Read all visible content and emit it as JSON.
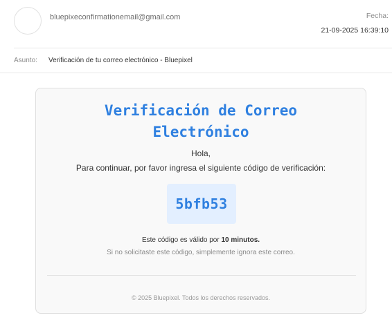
{
  "email": {
    "sender": "bluepixeconfirmationemail@gmail.com",
    "date_label": "Fecha:",
    "date_value": "21-09-2025 16:39:10",
    "subject_label": "Asunto:",
    "subject": "Verificación de tu correo electrónico - Bluepixel"
  },
  "body": {
    "title_line1": "Verificación de Correo",
    "title_line2": "Electrónico",
    "greeting": "Hola,",
    "instruction": "Para continuar, por favor ingresa el siguiente código de verificación:",
    "code": "5bfb53",
    "validity_prefix": "Este código es válido por ",
    "validity_bold": "10 minutos.",
    "ignore_note": "Si no solicitaste este código, simplemente ignora este correo.",
    "footer": "© 2025 Bluepixel. Todos los derechos reservados."
  },
  "colors": {
    "accent": "#2f80e0",
    "code_bg": "#e3efff",
    "card_bg": "#f9f9f9"
  }
}
